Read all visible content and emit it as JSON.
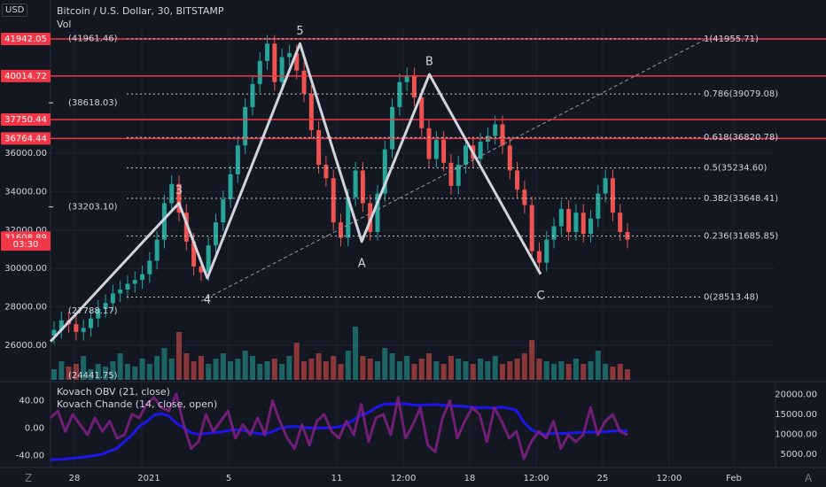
{
  "header": {
    "currency": "USD",
    "title": "Bitcoin / U.S. Dollar, 30, BITSTAMP",
    "volume_label": "Vol"
  },
  "indicators": {
    "obv": "Kovach OBV (21, close)",
    "chande": "Kovach Chande (14, close, open)"
  },
  "chart_data": [
    {
      "type": "line",
      "title": "Bitcoin / U.S. Dollar, 30, BITSTAMP",
      "y_axis_position": "left",
      "y_ticks": [
        26000,
        28000,
        30000,
        32000,
        34000,
        36000
      ],
      "y_tick_labels": [
        "26000.00",
        "28000.00",
        "30000.00",
        "32000.00",
        "34000.00",
        "36000.00"
      ],
      "ylim": [
        24441.75,
        41961.46
      ],
      "price_scale_labels": [
        {
          "text": "41942.05",
          "value": 41942.05,
          "color": "#f23645"
        },
        {
          "text": "40014.72",
          "value": 40014.72,
          "color": "#f23645"
        },
        {
          "text": "38618.03",
          "value": 38618.03,
          "color": ""
        },
        {
          "text": "37750.44",
          "value": 37750.44,
          "color": "#f23645"
        },
        {
          "text": "36764.44",
          "value": 36764.44,
          "color": "#f23645"
        },
        {
          "text": "33203.10",
          "value": 33203.1,
          "color": ""
        },
        {
          "text": "31608.89",
          "value": 31608.89,
          "color": "#f23645"
        },
        {
          "text": "03:30",
          "value": 31250,
          "color": "#f23645"
        }
      ],
      "horizontal_levels": [
        41942.05,
        40014.72,
        37750.44,
        36764.44
      ],
      "fibonacci": [
        {
          "label": "1(41955.71)",
          "value": 41955.71
        },
        {
          "label": "0.786(39079.08)",
          "value": 39079.08
        },
        {
          "label": "0.618(36820.78)",
          "value": 36820.78
        },
        {
          "label": "0.5(35234.60)",
          "value": 35234.6
        },
        {
          "label": "0.382(33648.41)",
          "value": 33648.41
        },
        {
          "label": "0.236(31685.85)",
          "value": 31685.85
        },
        {
          "label": "0(28513.48)",
          "value": 28513.48
        }
      ],
      "price_annotations": [
        {
          "text": "(41961.46)",
          "value": 41961.46
        },
        {
          "text": "(38618.03)",
          "value": 38618.03
        },
        {
          "text": "(33203.10)",
          "value": 33203.1
        },
        {
          "text": "(27788.17)",
          "value": 27788.17
        },
        {
          "text": "(24441.75)",
          "value": 24441.75
        }
      ],
      "elliott_wave": [
        {
          "label": "",
          "x": 0.0,
          "y": 26200
        },
        {
          "label": "3",
          "x": 0.262,
          "y": 33400
        },
        {
          "label": "4",
          "x": 0.32,
          "y": 29500
        },
        {
          "label": "5",
          "x": 0.509,
          "y": 41700
        },
        {
          "label": "A",
          "x": 0.635,
          "y": 31400
        },
        {
          "label": "B",
          "x": 0.773,
          "y": 40100
        },
        {
          "label": "C",
          "x": 1.0,
          "y": 29700
        }
      ],
      "x_ticks": [
        "28",
        "2021",
        "5",
        "11",
        "12:00",
        "18",
        "12:00",
        "25",
        "12:00",
        "Feb"
      ],
      "price_series": [
        26800,
        27300,
        27100,
        26700,
        26900,
        27400,
        27900,
        28200,
        28700,
        28900,
        29200,
        29400,
        29700,
        30400,
        31500,
        33400,
        34400,
        32900,
        31400,
        30100,
        29800,
        31200,
        32400,
        33600,
        34900,
        36400,
        38400,
        39600,
        40800,
        41700,
        39700,
        41000,
        41200,
        40300,
        39100,
        37200,
        35400,
        34700,
        32400,
        31600,
        33700,
        35100,
        33400,
        31900,
        33900,
        36200,
        38400,
        39700,
        40000,
        38900,
        37300,
        35700,
        36700,
        35500,
        34300,
        35400,
        36400,
        35700,
        36600,
        36900,
        37500,
        36400,
        35100,
        34100,
        33300,
        30900,
        30300,
        31500,
        32200,
        33100,
        31900,
        32900,
        31800,
        32600,
        33900,
        34700,
        32900,
        31900,
        31500
      ],
      "volume_series": [
        0.2,
        0.35,
        0.25,
        0.3,
        0.45,
        0.2,
        0.3,
        0.25,
        0.35,
        0.5,
        0.3,
        0.25,
        0.4,
        0.3,
        0.45,
        0.6,
        0.4,
        0.9,
        0.5,
        0.35,
        0.45,
        0.3,
        0.4,
        0.5,
        0.35,
        0.4,
        0.55,
        0.45,
        0.3,
        0.35,
        0.4,
        0.3,
        0.45,
        0.7,
        0.35,
        0.4,
        0.5,
        0.35,
        0.45,
        0.3,
        0.55,
        1.0,
        0.45,
        0.4,
        0.35,
        0.6,
        0.5,
        0.35,
        0.45,
        0.3,
        0.4,
        0.5,
        0.35,
        0.3,
        0.45,
        0.4,
        0.35,
        0.3,
        0.4,
        0.35,
        0.45,
        0.3,
        0.35,
        0.4,
        0.5,
        0.75,
        0.4,
        0.35,
        0.3,
        0.35,
        0.3,
        0.4,
        0.3,
        0.35,
        0.55,
        0.3,
        0.25,
        0.3,
        0.2
      ]
    },
    {
      "type": "line",
      "title": "Kovach OBV / Kovach Chande",
      "series": [
        {
          "name": "Kovach OBV (21, close)",
          "color": "#1c16e8",
          "y_axis": "right",
          "values": [
            3600,
            3700,
            3800,
            4000,
            4200,
            4400,
            4700,
            5000,
            5800,
            6500,
            8200,
            9800,
            12000,
            13200,
            14800,
            15200,
            14600,
            12800,
            11600,
            10400,
            10000,
            10200,
            10400,
            10600,
            10900,
            11200,
            11000,
            10600,
            10200,
            10000,
            10700,
            11500,
            11900,
            12000,
            11800,
            11600,
            11600,
            11600,
            11700,
            11900,
            12500,
            13600,
            14800,
            15500,
            16700,
            17500,
            17600,
            17700,
            17600,
            17400,
            17300,
            17400,
            17500,
            17300,
            17200,
            17100,
            17000,
            16800,
            16700,
            16700,
            16600,
            16800,
            16500,
            16000,
            13000,
            11200,
            10200,
            10000,
            10300,
            10200,
            10300,
            10400,
            10500,
            10600,
            10500,
            10600,
            10800,
            10900,
            10800
          ]
        },
        {
          "name": "Kovach Chande (14, close, open)",
          "color": "#7b1f7f",
          "y_axis": "left",
          "values": [
            15,
            25,
            -5,
            20,
            5,
            -10,
            15,
            -5,
            10,
            -15,
            -10,
            20,
            15,
            35,
            45,
            30,
            25,
            50,
            5,
            -30,
            -20,
            20,
            -5,
            10,
            25,
            -15,
            5,
            -10,
            15,
            -10,
            40,
            10,
            -15,
            -30,
            5,
            -25,
            10,
            20,
            -5,
            -15,
            10,
            -10,
            35,
            -20,
            15,
            20,
            -10,
            45,
            -15,
            5,
            30,
            -25,
            -35,
            15,
            40,
            -15,
            10,
            30,
            20,
            -20,
            30,
            10,
            -15,
            -5,
            -45,
            -20,
            -5,
            -15,
            10,
            -30,
            -10,
            -20,
            -10,
            30,
            -10,
            10,
            20,
            -5,
            -10
          ]
        }
      ],
      "left_ticks": [
        "40.00",
        "0.00",
        "-40.00"
      ],
      "left_tick_values": [
        40,
        0,
        -40
      ],
      "right_ticks": [
        "20000.00",
        "15000.00",
        "10000.00",
        "5000.00"
      ],
      "right_tick_values": [
        20000,
        15000,
        10000,
        5000
      ],
      "left_range": [
        -50,
        55
      ],
      "right_range": [
        3000,
        21000
      ]
    }
  ],
  "colors": {
    "background": "#131722",
    "grid": "#1e2230",
    "level_line": "#f23645",
    "wave_line": "#d1d4dc",
    "candle_up": "#26a69a",
    "candle_down": "#ef5350",
    "fib_line": "#c8c8c8",
    "trend_line": "#9598a1"
  }
}
